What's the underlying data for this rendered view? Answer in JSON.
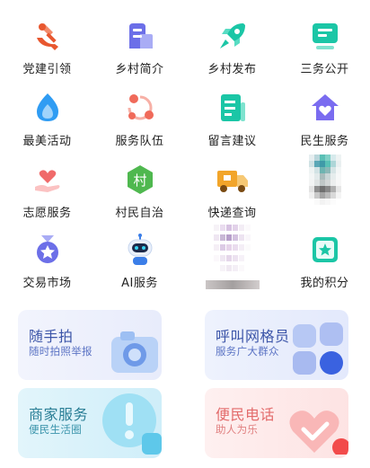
{
  "grid": {
    "items": [
      {
        "label": "党建引领",
        "icon": "party-emblem-icon",
        "color": "#e8572f"
      },
      {
        "label": "乡村简介",
        "icon": "village-building-icon",
        "color": "#6c6fe8"
      },
      {
        "label": "乡村发布",
        "icon": "rocket-icon",
        "color": "#1bc6a6"
      },
      {
        "label": "三务公开",
        "icon": "monitor-icon",
        "color": "#1bc6a6"
      },
      {
        "label": "最美活动",
        "icon": "flame-drop-icon",
        "color": "#2f9cf3"
      },
      {
        "label": "服务队伍",
        "icon": "team-network-icon",
        "color": "#f06a5a"
      },
      {
        "label": "留言建议",
        "icon": "document-lines-icon",
        "color": "#1bc6a6"
      },
      {
        "label": "民生服务",
        "icon": "home-heart-icon",
        "color": "#7a6cf0"
      },
      {
        "label": "志愿服务",
        "icon": "hand-heart-icon",
        "color": "#f06a6a"
      },
      {
        "label": "村民自治",
        "icon": "village-badge-icon",
        "color": "#4fb84f",
        "badge_text": "村"
      },
      {
        "label": "快递查询",
        "icon": "delivery-truck-icon",
        "color": "#f2a52a"
      },
      {
        "label": "",
        "icon": "pixelated-image",
        "color": "#5abfb5"
      },
      {
        "label": "交易市场",
        "icon": "medal-star-icon",
        "color": "#6c6fe8"
      },
      {
        "label": "AI服务",
        "icon": "robot-icon",
        "color": "#3b7ee8"
      },
      {
        "label": "",
        "icon": "pixelated-image",
        "color": "#c9b8d6"
      },
      {
        "label": "我的积分",
        "icon": "star-card-icon",
        "color": "#1bc6a6"
      }
    ]
  },
  "cards": [
    {
      "title": "随手拍",
      "subtitle": "随时拍照举报",
      "icon": "camera-icon",
      "title_color": "#3c55a8",
      "sub_color": "#5b73c4",
      "bg": "#eef1fd"
    },
    {
      "title": "呼叫网格员",
      "subtitle": "服务广大群众",
      "icon": "grid-tiles-icon",
      "title_color": "#3c55a8",
      "sub_color": "#5b73c4",
      "bg": "#e9eefc"
    },
    {
      "title": "商家服务",
      "subtitle": "便民生活圈",
      "icon": "alert-bubble-icon",
      "title_color": "#2a7e95",
      "sub_color": "#3b94ab",
      "bg": "#ddf3fb"
    },
    {
      "title": "便民电话",
      "subtitle": "助人为乐",
      "icon": "heart-check-icon",
      "title_color": "#e36b6b",
      "sub_color": "#e07f7f",
      "bg": "#fdecec"
    }
  ]
}
